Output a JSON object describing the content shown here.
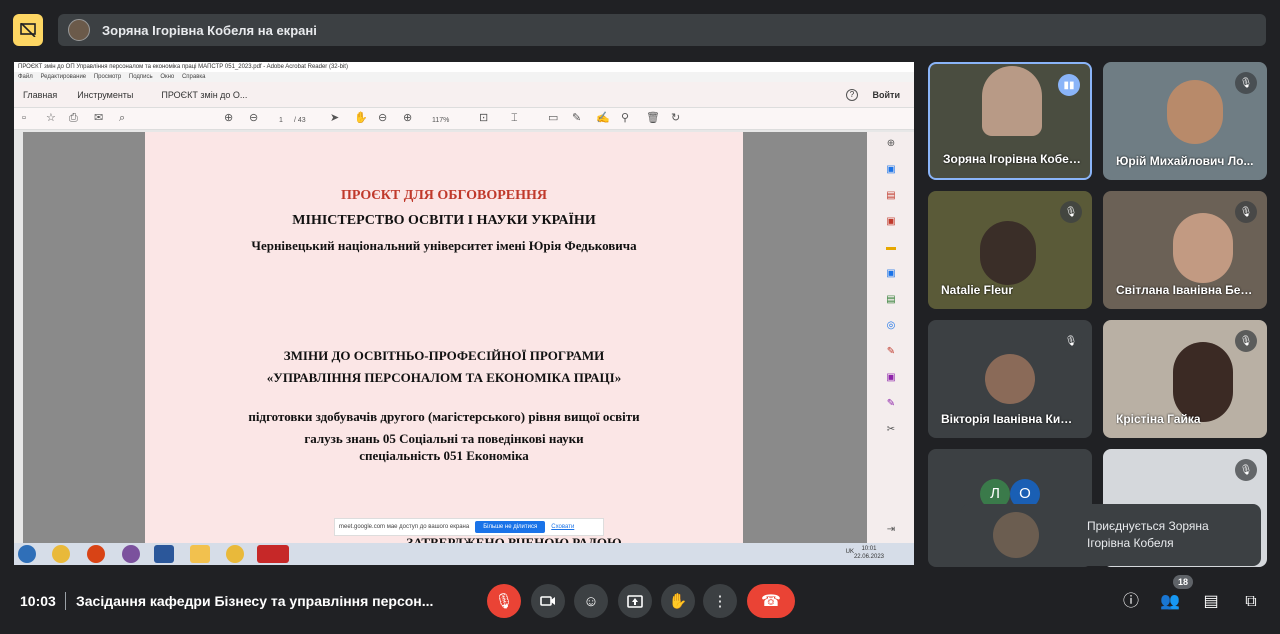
{
  "banner": {
    "presenter_text": "Зоряна Ігорівна Кобеля на екрані"
  },
  "acrobat": {
    "title": "ПРОЄКТ змін до ОП Управління персоналом та економіка праці МАПСТР 051_2023.pdf - Adobe Acrobat Reader (32-bit)",
    "menu": [
      "Файл",
      "Редактирование",
      "Просмотр",
      "Подпись",
      "Окно",
      "Справка"
    ],
    "tabs": [
      "Главная",
      "Инструменты"
    ],
    "doc_tab": "ПРОЄКТ змін до О...",
    "login": "Войти",
    "help": "?",
    "page_current": "1",
    "page_total": "/ 43",
    "zoom": "117%"
  },
  "pdf": {
    "line1": "ПРОЄКТ ДЛЯ ОБГОВОРЕННЯ",
    "line2": "МІНІСТЕРСТВО ОСВІТИ І НАУКИ УКРАЇНИ",
    "line3": "Чернівецький національний університет імені Юрія Федьковича",
    "line4": "ЗМІНИ ДО ОСВІТНЬО-ПРОФЕСІЙНОЇ ПРОГРАМИ",
    "line5": "«УПРАВЛІННЯ ПЕРСОНАЛОМ ТА ЕКОНОМІКА ПРАЦІ»",
    "line6": "підготовки здобувачів другого (магістерського) рівня вищої освіти",
    "line7": "галузь знань 05 Соціальні та поведінкові науки",
    "line8": "спеціальність  051 Економіка",
    "line9": "ЗАТВЕРДЖЕНО ВЧЕНОЮ РАДОЮ",
    "accent_color": "#c0392b"
  },
  "share_notice": {
    "text": "meet.google.com мае доступ до вашого екрана",
    "stop_label": "Більше не ділитися",
    "hide_label": "Сховати"
  },
  "taskbar": {
    "tray_lang": "UK",
    "clock_time": "10:01",
    "clock_date": "22.06.2023"
  },
  "participants": [
    {
      "name": "Зоряна Ігорівна Кобеля",
      "speaking": true
    },
    {
      "name": "Юрій Михайлович Ло...",
      "muted": true
    },
    {
      "name": "Natalie Fleur",
      "muted": true
    },
    {
      "name": "Світлана Іванівна Бел...",
      "muted": true
    },
    {
      "name": "Вікторія Іванівна Кифяк",
      "muted": true
    },
    {
      "name": "Крістіна Гайка",
      "muted": true
    },
    {
      "name": "",
      "initials": [
        "Л",
        "О"
      ]
    },
    {
      "name": "",
      "muted": true
    }
  ],
  "toast": {
    "text": "Приєднується Зоряна Ігорівна Кобеля"
  },
  "bottom": {
    "time": "10:03",
    "meeting_title": "Засідання кафедри Бізнесу та управління персон...",
    "people_count": "18"
  }
}
